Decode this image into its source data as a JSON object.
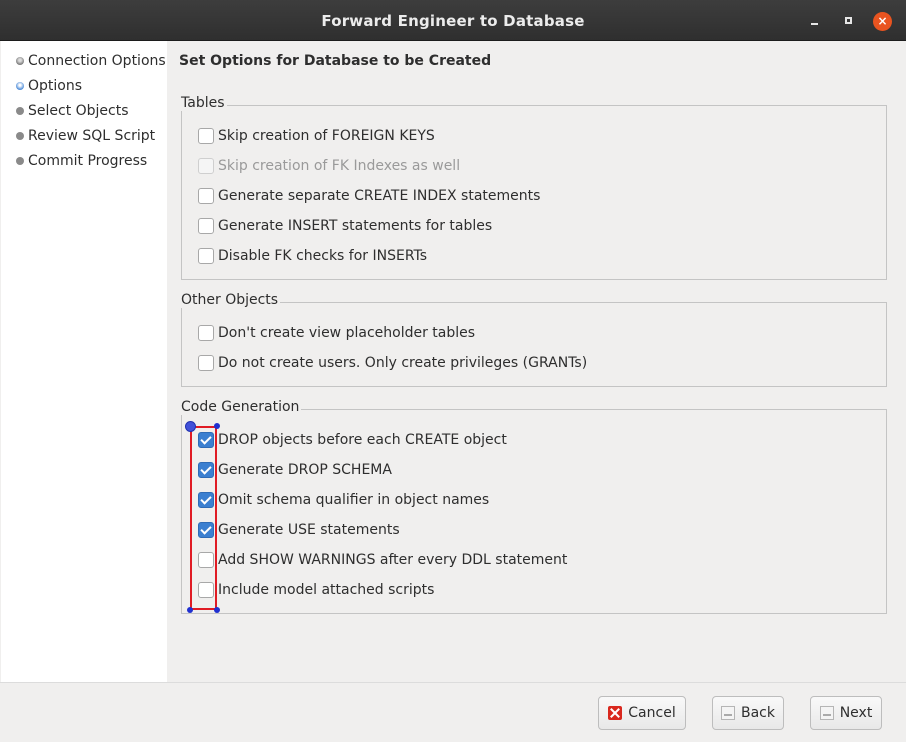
{
  "window": {
    "title": "Forward Engineer to Database"
  },
  "title_buttons": {
    "minimize": "–",
    "maximize": "□",
    "close": "×"
  },
  "steps": [
    {
      "label": "Connection Options",
      "state": "done"
    },
    {
      "label": "Options",
      "state": "current"
    },
    {
      "label": "Select Objects",
      "state": "pending"
    },
    {
      "label": "Review SQL Script",
      "state": "pending"
    },
    {
      "label": "Commit Progress",
      "state": "pending"
    }
  ],
  "page_title": "Set Options for Database to be Created",
  "groups": {
    "tables": {
      "label": "Tables",
      "options": [
        {
          "label": "Skip creation of FOREIGN KEYS",
          "checked": false,
          "enabled": true
        },
        {
          "label": "Skip creation of FK Indexes as well",
          "checked": false,
          "enabled": false
        },
        {
          "label": "Generate separate CREATE INDEX statements",
          "checked": false,
          "enabled": true
        },
        {
          "label": "Generate INSERT statements for tables",
          "checked": false,
          "enabled": true
        },
        {
          "label": "Disable FK checks for INSERTs",
          "checked": false,
          "enabled": true
        }
      ]
    },
    "other_objects": {
      "label": "Other Objects",
      "options": [
        {
          "label": "Don't create view placeholder tables",
          "checked": false,
          "enabled": true
        },
        {
          "label": "Do not create users. Only create privileges (GRANTs)",
          "checked": false,
          "enabled": true
        }
      ]
    },
    "code_generation": {
      "label": "Code Generation",
      "options": [
        {
          "label": "DROP objects before each CREATE object",
          "checked": true,
          "enabled": true
        },
        {
          "label": "Generate DROP SCHEMA",
          "checked": true,
          "enabled": true
        },
        {
          "label": "Omit schema qualifier in object names",
          "checked": true,
          "enabled": true
        },
        {
          "label": "Generate USE statements",
          "checked": true,
          "enabled": true
        },
        {
          "label": "Add SHOW WARNINGS after every DDL statement",
          "checked": false,
          "enabled": true
        },
        {
          "label": "Include model attached scripts",
          "checked": false,
          "enabled": true
        }
      ]
    }
  },
  "buttons": {
    "cancel": "Cancel",
    "back": "Back",
    "next": "Next"
  },
  "colors": {
    "accent": "#3b7fd0",
    "close": "#e95420",
    "selection": "#e01b24"
  }
}
